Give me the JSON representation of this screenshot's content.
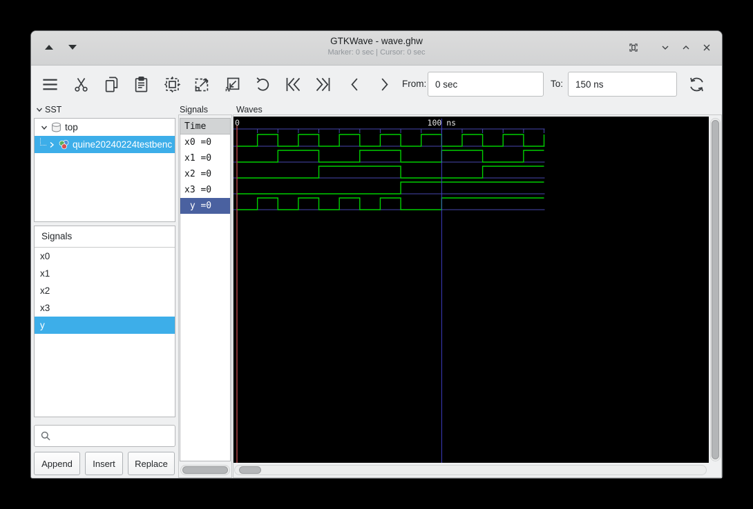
{
  "window": {
    "title": "GTKWave - wave.ghw",
    "status": "Marker: 0 sec | Cursor: 0 sec"
  },
  "toolbar": {
    "icons": [
      "menu",
      "cut",
      "copy",
      "paste",
      "zoom-fit",
      "zoom-in",
      "zoom-out",
      "undo",
      "to-start",
      "to-end",
      "prev-edge",
      "next-edge"
    ],
    "from_label": "From:",
    "from_value": "0 sec",
    "to_label": "To:",
    "to_value": "150 ns",
    "reload_icon": "reload"
  },
  "sst": {
    "label": "SST",
    "tree": [
      {
        "label": "top",
        "icon": "database-icon",
        "expanded": true,
        "selected": false
      },
      {
        "label": "quine20240224testbenc",
        "icon": "module-icon",
        "expanded": false,
        "selected": true
      }
    ]
  },
  "facilities": {
    "header": "Signals",
    "items": [
      "x0",
      "x1",
      "x2",
      "x3",
      "y"
    ],
    "selected_index": 4,
    "search_value": "",
    "buttons": [
      "Append",
      "Insert",
      "Replace"
    ]
  },
  "signal_values": {
    "label": "Signals",
    "time_header": "Time",
    "rows": [
      {
        "name": "x0",
        "value": "=0"
      },
      {
        "name": "x1",
        "value": "=0"
      },
      {
        "name": "x2",
        "value": "=0"
      },
      {
        "name": "x3",
        "value": "=0"
      },
      {
        "name": "y",
        "value": "=0"
      }
    ],
    "selected_index": 4
  },
  "waves": {
    "label": "Waves"
  },
  "chart_data": {
    "type": "digital-waveform",
    "time_unit": "ns",
    "t_start": 0,
    "t_end": 150,
    "tick_step_ns": 10,
    "labeled_ticks": [
      {
        "t": 0,
        "label": "0"
      },
      {
        "t": 100,
        "label": "100 ns"
      }
    ],
    "marker_time_ns": 0,
    "gridline_time_ns": 100,
    "signals": [
      {
        "name": "x0",
        "initial": 0,
        "transition_times_ns": [
          10,
          20,
          30,
          40,
          50,
          60,
          70,
          80,
          90,
          100,
          110,
          120,
          130,
          140,
          150
        ]
      },
      {
        "name": "x1",
        "initial": 0,
        "transition_times_ns": [
          20,
          40,
          60,
          80,
          100,
          120,
          140
        ]
      },
      {
        "name": "x2",
        "initial": 0,
        "transition_times_ns": [
          40,
          80,
          120
        ]
      },
      {
        "name": "x3",
        "initial": 0,
        "transition_times_ns": [
          80
        ]
      },
      {
        "name": "y",
        "initial": 0,
        "transition_times_ns": [
          10,
          20,
          30,
          40,
          50,
          60,
          70,
          80,
          100
        ]
      }
    ]
  },
  "colors": {
    "wave_green": "#00d000",
    "grid_blue": "#4848b0",
    "marker_red": "#b84a4a",
    "selection_light_blue": "#3daee9",
    "selection_navy": "#4a61a0",
    "canvas_black": "#000000"
  }
}
